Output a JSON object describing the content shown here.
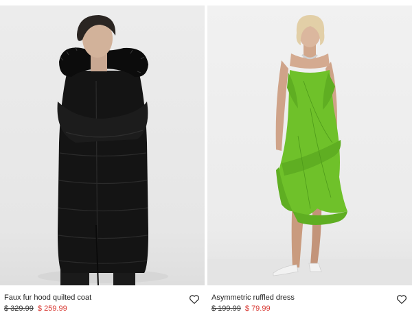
{
  "products": [
    {
      "name": "Faux fur hood quilted coat",
      "old_price": "$ 329.99",
      "sale_price": "$ 259.99",
      "icon": "heart-outline-icon"
    },
    {
      "name": "Asymmetric ruffled dress",
      "old_price": "$ 199.99",
      "sale_price": "$ 79.99",
      "icon": "heart-outline-icon"
    }
  ],
  "colors": {
    "sale_price": "#d83a34",
    "dress": "#6fc12a",
    "coat": "#141414"
  }
}
